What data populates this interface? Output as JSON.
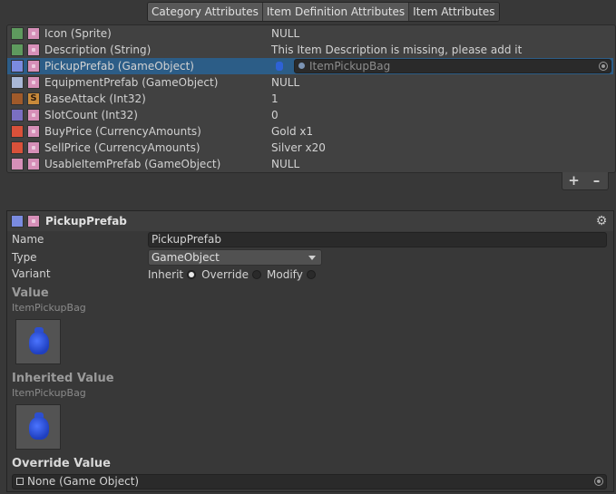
{
  "tabs": [
    {
      "label": "Category Attributes",
      "active": false
    },
    {
      "label": "Item Definition Attributes",
      "active": false
    },
    {
      "label": "Item Attributes",
      "active": true
    }
  ],
  "attributes": [
    {
      "label": "Icon (Sprite)",
      "value": "NULL",
      "color1": "#5e9a5e",
      "color2": "#d68fb8"
    },
    {
      "label": "Description (String)",
      "value": "This Item Description is missing, please add it",
      "color1": "#5e9a5e",
      "color2": "#d68fb8"
    },
    {
      "label": "PickupPrefab (GameObject)",
      "value": "ItemPickupBag",
      "color1": "#7a8be0",
      "color2": "#d68fb8",
      "selected": true
    },
    {
      "label": "EquipmentPrefab (GameObject)",
      "value": "NULL",
      "color1": "#a9b7d6",
      "color2": "#d68fb8"
    },
    {
      "label": "BaseAttack (Int32)",
      "value": "1",
      "color1": "#a05a2a",
      "color2": "#c88a3a",
      "letter": "S"
    },
    {
      "label": "SlotCount (Int32)",
      "value": "0",
      "color1": "#7a6fc2",
      "color2": "#d68fb8"
    },
    {
      "label": "BuyPrice (CurrencyAmounts)",
      "value": "Gold x1",
      "color1": "#d9513a",
      "color2": "#d68fb8"
    },
    {
      "label": "SellPrice (CurrencyAmounts)",
      "value": "Silver x20",
      "color1": "#d9513a",
      "color2": "#d68fb8"
    },
    {
      "label": "UsableItemPrefab (GameObject)",
      "value": "NULL",
      "color1": "#d68fb8",
      "color2": "#d68fb8"
    }
  ],
  "list_buttons": {
    "add": "+",
    "remove": "–"
  },
  "detail": {
    "title": "PickupPrefab",
    "name_label": "Name",
    "name_value": "PickupPrefab",
    "type_label": "Type",
    "type_value": "GameObject",
    "variant_label": "Variant",
    "variant_options": [
      {
        "label": "Inherit",
        "selected": true
      },
      {
        "label": "Override",
        "selected": false
      },
      {
        "label": "Modify",
        "selected": false
      }
    ],
    "value_title": "Value",
    "value_name": "ItemPickupBag",
    "inherited_title": "Inherited Value",
    "inherited_name": "ItemPickupBag",
    "override_title": "Override Value",
    "override_field": "None (Game Object)"
  }
}
